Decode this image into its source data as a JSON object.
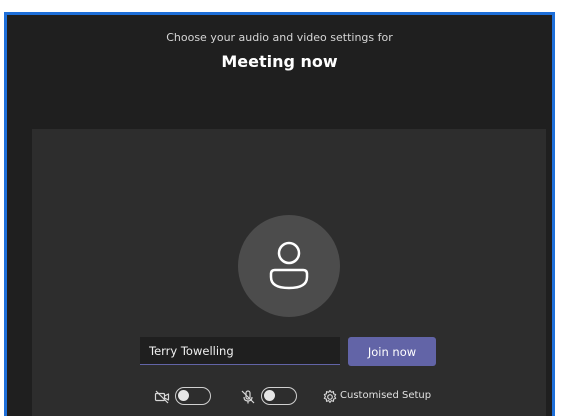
{
  "header": {
    "prompt": "Choose your audio and video settings for",
    "meeting_title": "Meeting now"
  },
  "join": {
    "name_value": "Terry Towelling",
    "join_label": "Join now"
  },
  "controls": {
    "camera": {
      "icon": "camera-off-icon",
      "state": "off"
    },
    "mic": {
      "icon": "mic-off-icon",
      "state": "off"
    },
    "setup": {
      "icon": "gear-icon",
      "label": "Customised Setup"
    }
  },
  "colors": {
    "accent": "#6264a7",
    "window_border": "#1e6fd9",
    "background": "#1f1f1f",
    "preview": "#2d2d2d"
  }
}
